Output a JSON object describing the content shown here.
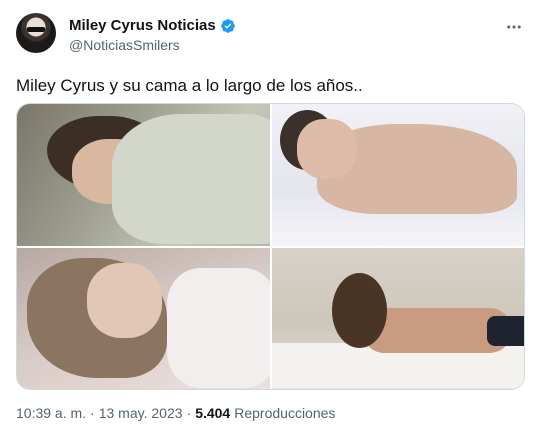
{
  "author": {
    "display_name": "Miley Cyrus Noticias",
    "handle": "@NoticiasSmilers",
    "verified_icon": "verified-badge-icon",
    "verified_color": "#1d9bf0"
  },
  "tweet": {
    "text": "Miley Cyrus y su cama a lo largo de los años.."
  },
  "media": {
    "images": [
      {
        "label": "photo-1"
      },
      {
        "label": "photo-2"
      },
      {
        "label": "photo-3"
      },
      {
        "label": "photo-4"
      }
    ]
  },
  "meta": {
    "time": "10:39 a. m.",
    "separator": "·",
    "date": "13 may. 2023",
    "views_count": "5.404",
    "views_label": "Reproducciones"
  },
  "icons": {
    "more": "more-icon"
  },
  "colors": {
    "text": "#0f1419",
    "secondary": "#536471",
    "border": "#cfd9de",
    "verified": "#1d9bf0"
  }
}
